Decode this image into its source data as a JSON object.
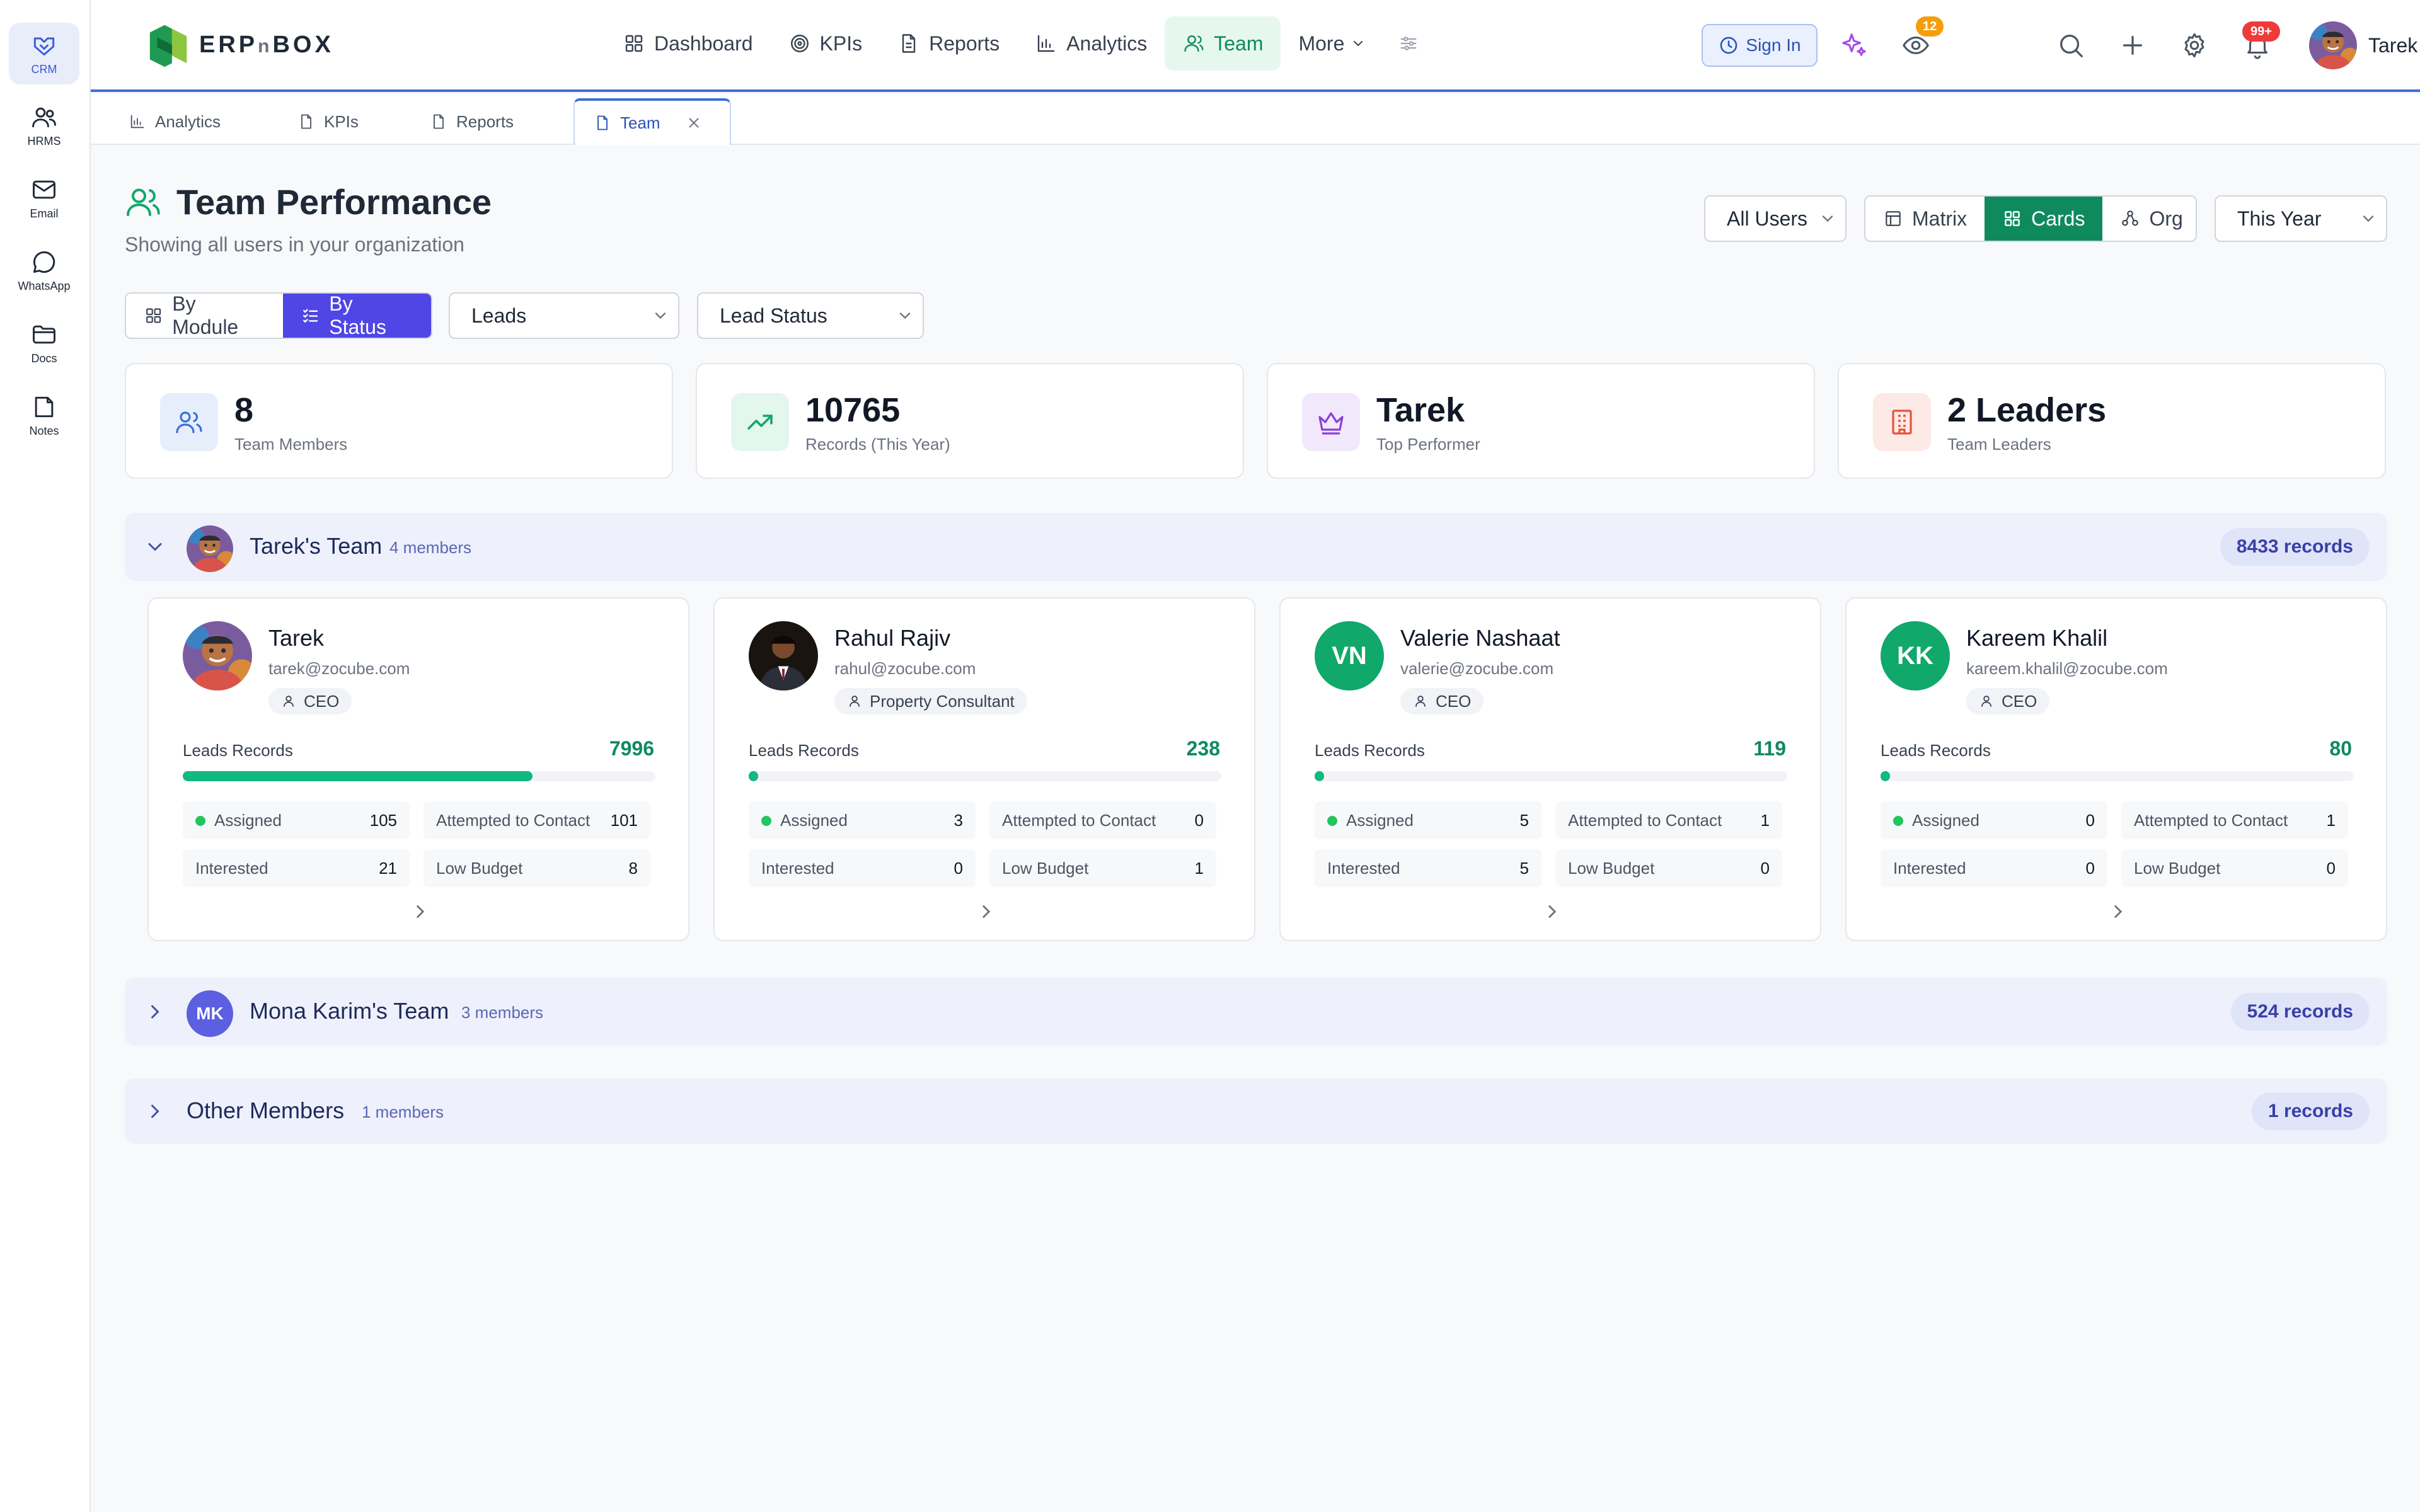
{
  "sidebar": {
    "items": [
      {
        "label": "CRM",
        "icon": "handshake-icon",
        "active": true
      },
      {
        "label": "HRMS",
        "icon": "users-icon"
      },
      {
        "label": "Email",
        "icon": "mail-icon"
      },
      {
        "label": "WhatsApp",
        "icon": "chat-bubble-icon"
      },
      {
        "label": "Docs",
        "icon": "folder-icon"
      },
      {
        "label": "Notes",
        "icon": "note-icon"
      }
    ]
  },
  "header": {
    "logo_main": "ERP",
    "logo_mid": "n",
    "logo_end": "BOX",
    "nav": [
      {
        "label": "Dashboard",
        "icon": "grid-icon"
      },
      {
        "label": "KPIs",
        "icon": "target-icon"
      },
      {
        "label": "Reports",
        "icon": "document-icon"
      },
      {
        "label": "Analytics",
        "icon": "bar-chart-icon"
      },
      {
        "label": "Team",
        "icon": "user-icon",
        "active": true
      },
      {
        "label": "More",
        "icon": "chevron-down-icon"
      }
    ],
    "sign_in_label": "Sign In",
    "watch_badge": "12",
    "notification_badge": "99+",
    "user_name": "Tarek"
  },
  "tabs": [
    {
      "label": "Analytics",
      "icon": "bar-chart-icon"
    },
    {
      "label": "KPIs",
      "icon": "document-icon"
    },
    {
      "label": "Reports",
      "icon": "document-icon"
    },
    {
      "label": "Team",
      "icon": "document-icon",
      "active": true
    }
  ],
  "page": {
    "title": "Team Performance",
    "subtitle": "Showing all users in your organization",
    "user_filter": "All Users",
    "views": [
      "Matrix",
      "Cards",
      "Org"
    ],
    "active_view": "Cards",
    "period": "This Year",
    "group_modes": [
      "By Module",
      "By Status"
    ],
    "active_group_mode": "By Status",
    "module_select": "Leads",
    "status_select": "Lead Status"
  },
  "stats": [
    {
      "value": "8",
      "label": "Team Members",
      "icon": "users-icon",
      "color": "#3b6fd8",
      "bg": "#e6eefc"
    },
    {
      "value": "10765",
      "label": "Records (This Year)",
      "icon": "trending-up-icon",
      "color": "#10a86b",
      "bg": "#e3f7ec"
    },
    {
      "value": "Tarek",
      "label": "Top Performer",
      "icon": "crown-icon",
      "color": "#8b3fd9",
      "bg": "#f1e8fc"
    },
    {
      "value": "2 Leaders",
      "label": "Team Leaders",
      "icon": "building-icon",
      "color": "#e5533d",
      "bg": "#fde9e5"
    }
  ],
  "teams": [
    {
      "name": "Tarek's Team",
      "members_label": "4 members",
      "records_label": "8433 records",
      "expanded": true,
      "cards": [
        {
          "name": "Tarek",
          "email": "tarek@zocube.com",
          "role": "CEO",
          "records_label": "Leads Records",
          "records": "7996",
          "progress": 0.74,
          "statuses": [
            {
              "label": "Assigned",
              "value": "105",
              "dot": true
            },
            {
              "label": "Attempted to Contact",
              "value": "101"
            },
            {
              "label": "Interested",
              "value": "21"
            },
            {
              "label": "Low Budget",
              "value": "8"
            }
          ]
        },
        {
          "name": "Rahul Rajiv",
          "email": "rahul@zocube.com",
          "role": "Property Consultant",
          "records_label": "Leads Records",
          "records": "238",
          "progress": 0.02,
          "statuses": [
            {
              "label": "Assigned",
              "value": "3",
              "dot": true
            },
            {
              "label": "Attempted to Contact",
              "value": "0"
            },
            {
              "label": "Interested",
              "value": "0"
            },
            {
              "label": "Low Budget",
              "value": "1"
            }
          ]
        },
        {
          "name": "Valerie Nashaat",
          "email": "valerie@zocube.com",
          "role": "CEO",
          "initials": "VN",
          "records_label": "Leads Records",
          "records": "119",
          "progress": 0.01,
          "statuses": [
            {
              "label": "Assigned",
              "value": "5",
              "dot": true
            },
            {
              "label": "Attempted to Contact",
              "value": "1"
            },
            {
              "label": "Interested",
              "value": "5"
            },
            {
              "label": "Low Budget",
              "value": "0"
            }
          ]
        },
        {
          "name": "Kareem Khalil",
          "email": "kareem.khalil@zocube.com",
          "role": "CEO",
          "initials": "KK",
          "records_label": "Leads Records",
          "records": "80",
          "progress": 0.005,
          "statuses": [
            {
              "label": "Assigned",
              "value": "0",
              "dot": true
            },
            {
              "label": "Attempted to Contact",
              "value": "1"
            },
            {
              "label": "Interested",
              "value": "0"
            },
            {
              "label": "Low Budget",
              "value": "0"
            }
          ]
        }
      ]
    },
    {
      "name": "Mona Karim's Team",
      "initials": "MK",
      "members_label": "3 members",
      "records_label": "524 records",
      "expanded": false
    },
    {
      "name": "Other Members",
      "members_label": "1 members",
      "records_label": "1 records",
      "expanded": false
    }
  ]
}
